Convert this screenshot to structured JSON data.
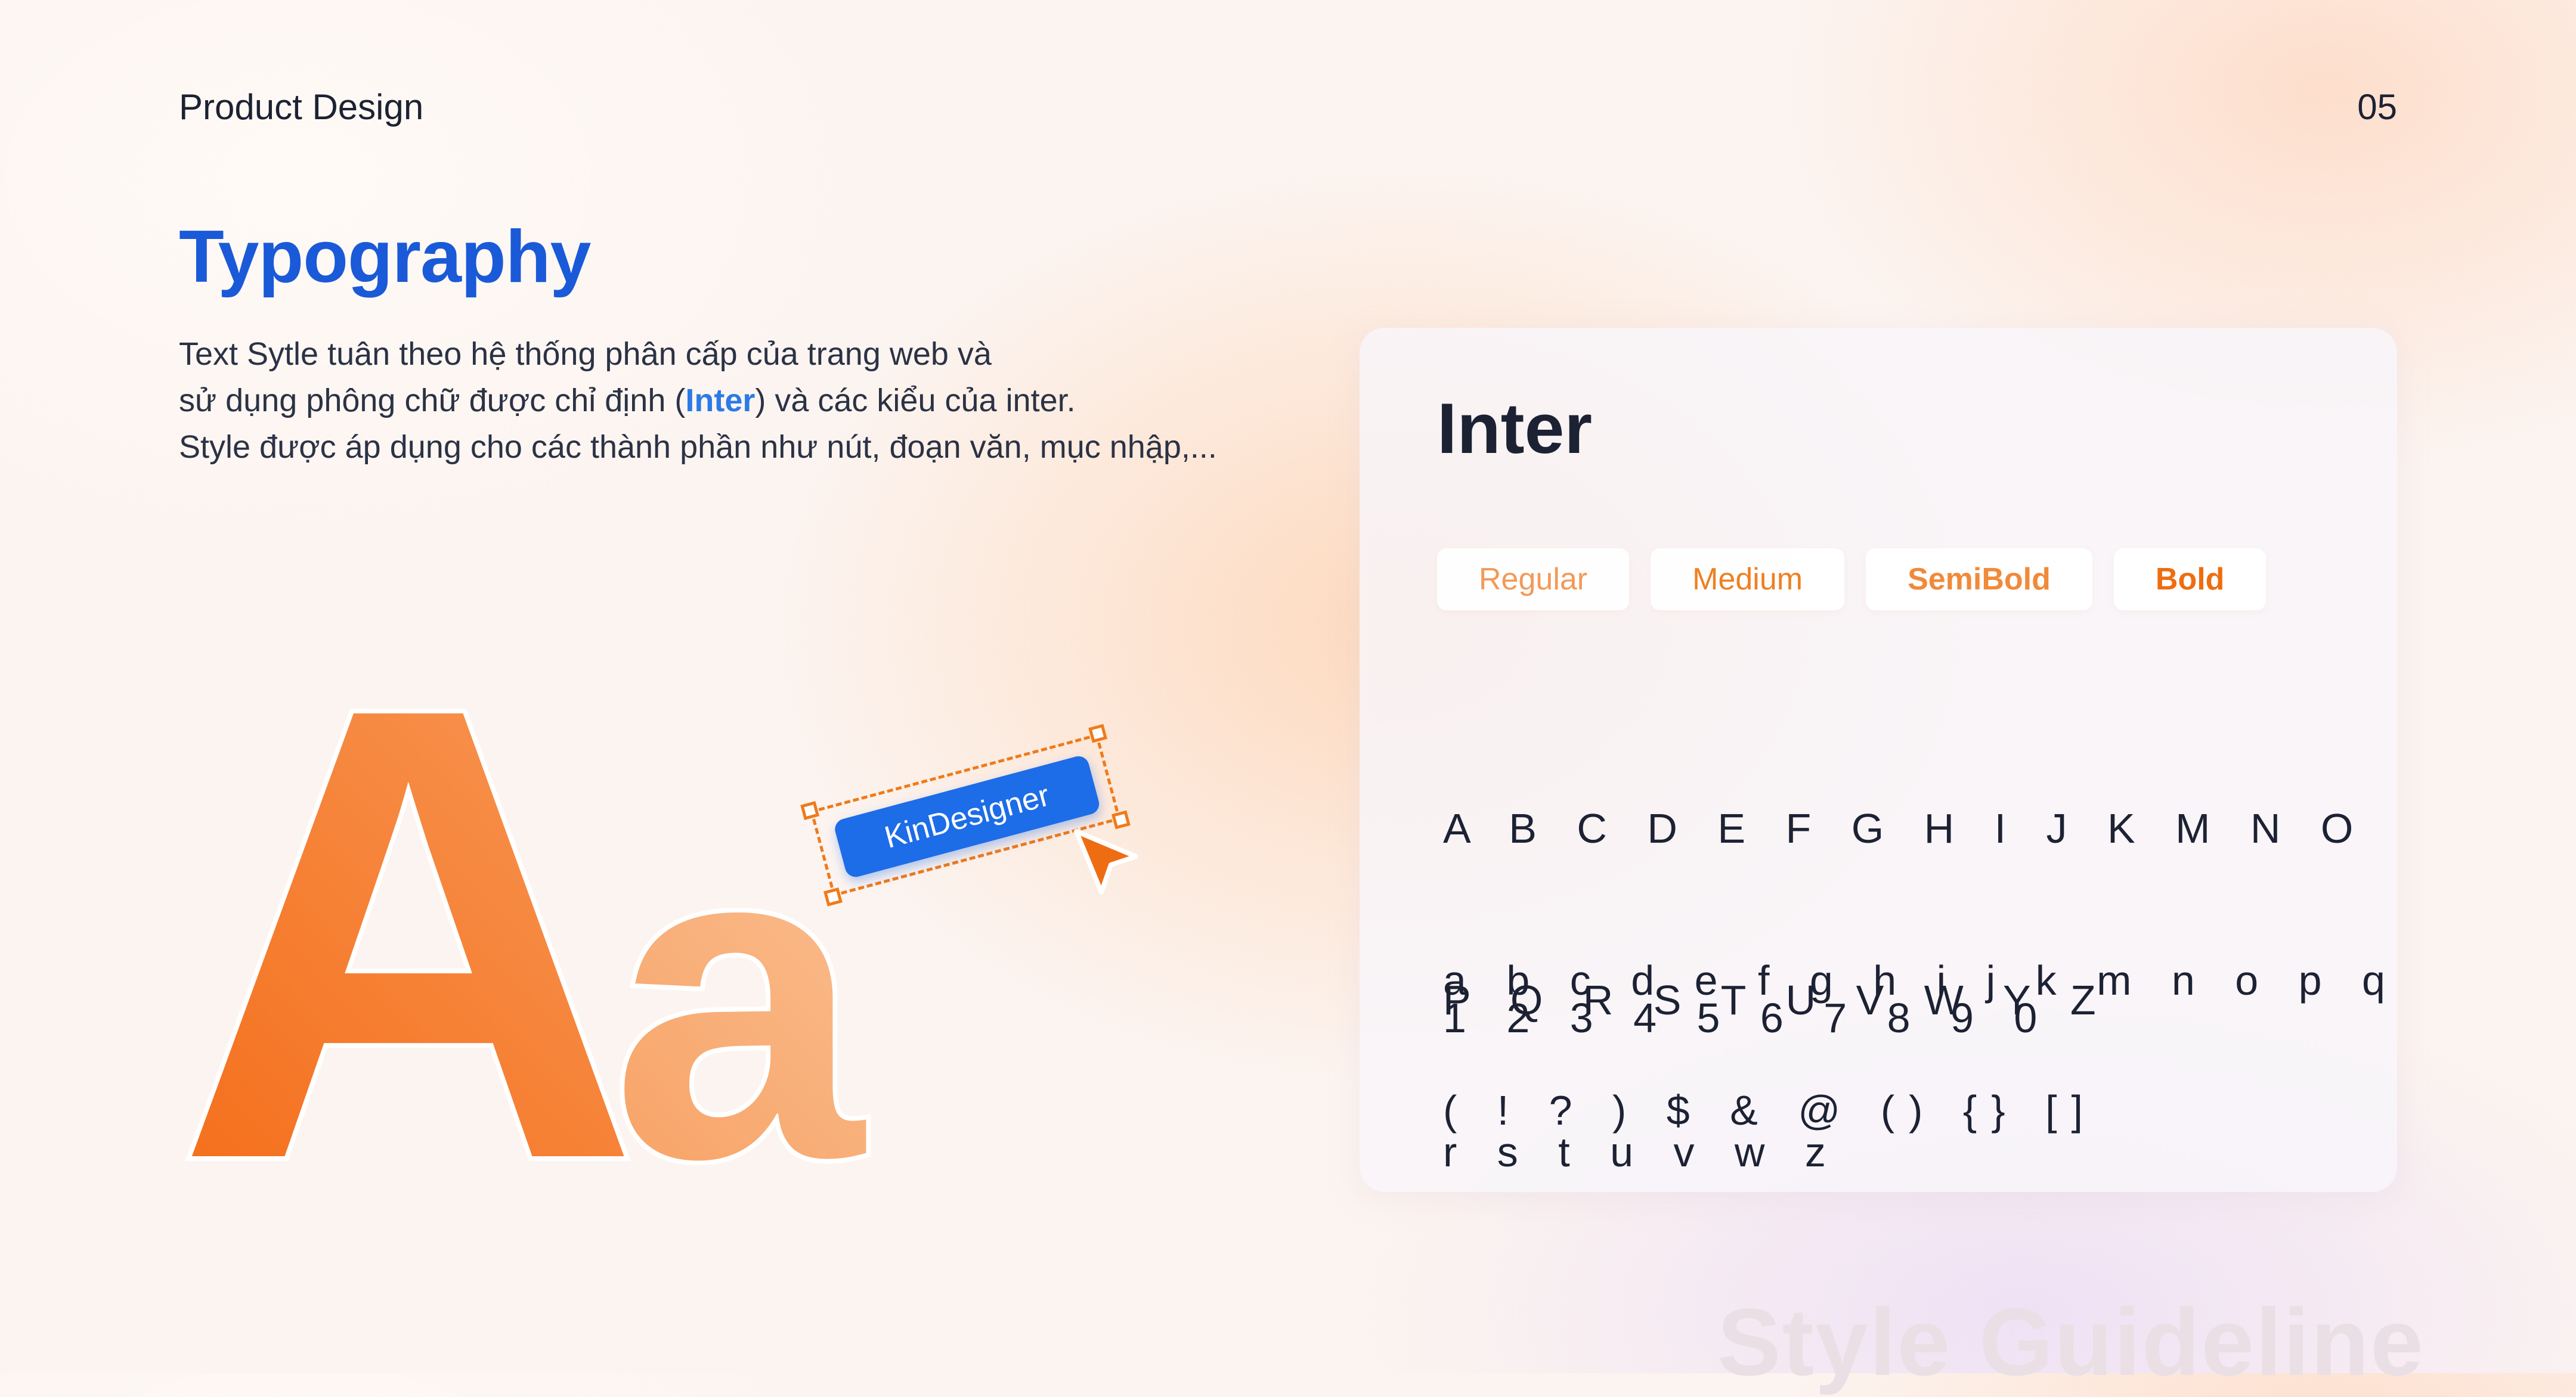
{
  "header": {
    "brand": "Product Design",
    "page_number": "05"
  },
  "section": {
    "title": "Typography",
    "desc_line1": "Text Sytle tuân theo hệ thống phân cấp của trang web và",
    "desc_line2_pre": "sử dụng phông chữ được chỉ định (",
    "desc_line2_highlight": "Inter",
    "desc_line2_post": ") và các kiểu của inter.",
    "desc_line3": "Style được áp dụng cho các thành phần như nút, đoạn văn, mục nhập,..."
  },
  "showcase": {
    "letters": "Aa",
    "tag_label": "KinDesigner"
  },
  "card": {
    "font_name": "Inter",
    "weights": [
      {
        "label": "Regular"
      },
      {
        "label": "Medium"
      },
      {
        "label": "SemiBold"
      },
      {
        "label": "Bold"
      }
    ],
    "uppercase_line1": "A B C D E F G H I J K M N O",
    "uppercase_line2": "P Q R S T U V W Y Z",
    "lowercase_line1": "a b c d e f g h i j k m n o p q",
    "lowercase_line2": "r s t u v w z",
    "numbers": "1 2 3 4 5 6 7 8 9 0",
    "symbols": "( ! ? ) $ & @ () {} []"
  },
  "watermark": "Style Guideline",
  "colors": {
    "title_blue": "#1a5ad8",
    "accent_orange": "#f07a1a",
    "tag_blue": "#1d6ce8",
    "text_dark": "#1c2233"
  },
  "icons": {
    "cursor": "pointer-arrow-icon"
  }
}
